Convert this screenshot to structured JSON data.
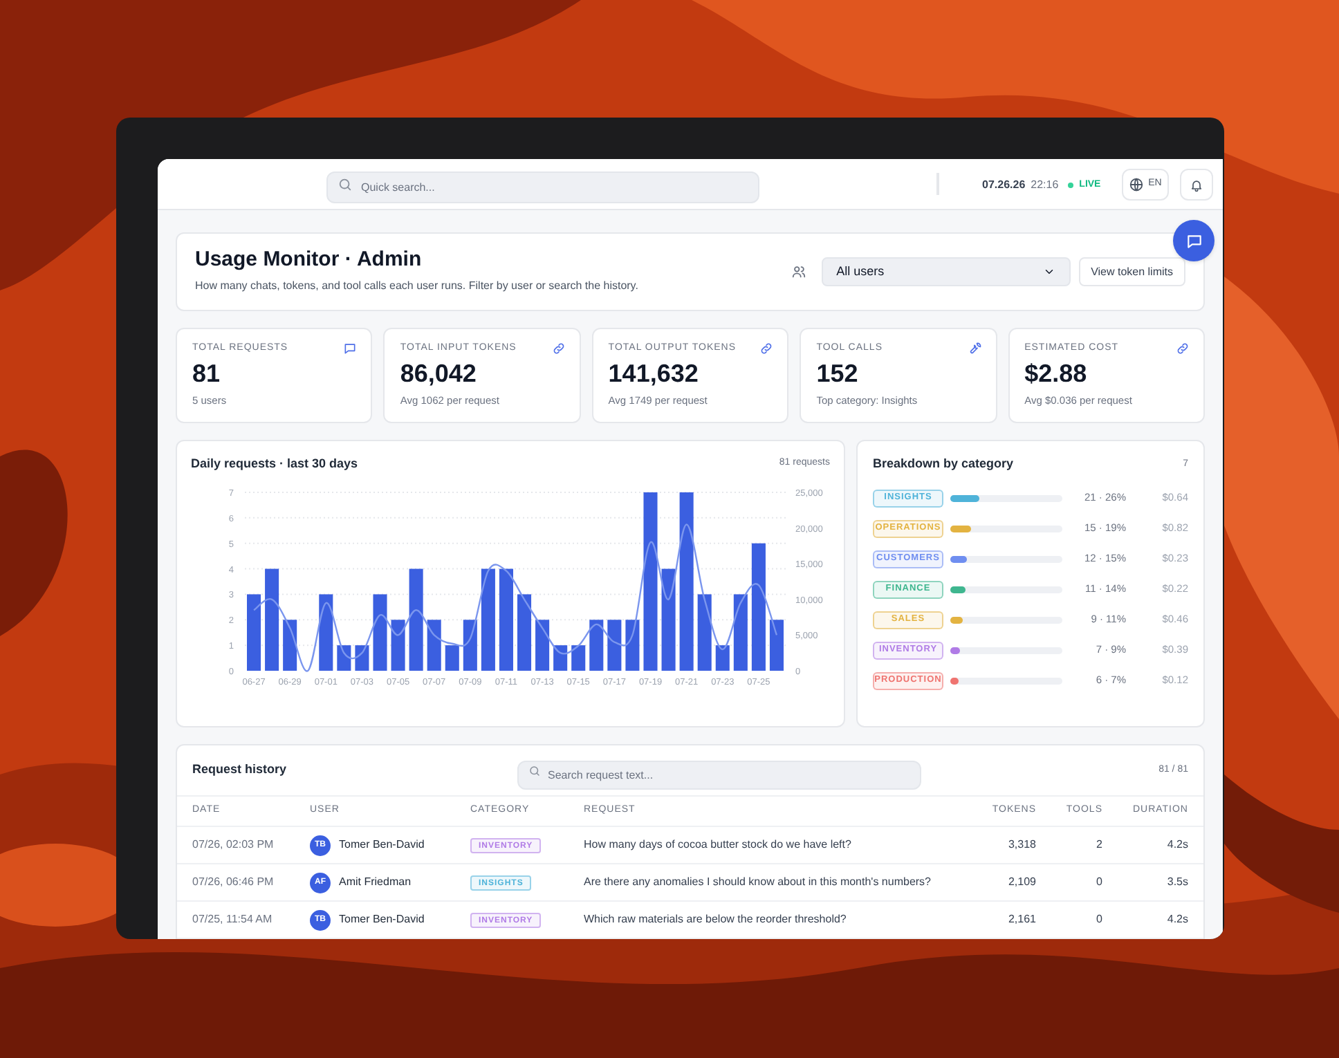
{
  "topbar": {
    "search": {
      "placeholder": "Quick search..."
    },
    "date": "07.26.26",
    "time": "22:16",
    "live": "LIVE",
    "language": "EN"
  },
  "header": {
    "title": "Usage Monitor · Admin",
    "subtitle": "How many chats, tokens, and tool calls each user runs. Filter by user or search the history.",
    "user_filter": "All users",
    "limits_button": "View token limits"
  },
  "stats": [
    {
      "label": "TOTAL REQUESTS",
      "value": "81",
      "note": "5 users"
    },
    {
      "label": "TOTAL INPUT TOKENS",
      "value": "86,042",
      "note": "Avg 1062 per request"
    },
    {
      "label": "TOTAL OUTPUT TOKENS",
      "value": "141,632",
      "note": "Avg 1749 per request"
    },
    {
      "label": "TOOL CALLS",
      "value": "152",
      "note": "Top category: Insights"
    },
    {
      "label": "ESTIMATED COST",
      "value": "$2.88",
      "note": "Avg $0.036 per request"
    }
  ],
  "daily": {
    "title": "Daily requests · last 30 days",
    "count": "81 requests",
    "chart_data": {
      "type": "bar",
      "grid": true,
      "categories": [
        "06-27",
        null,
        "06-29",
        null,
        "07-01",
        null,
        "07-03",
        null,
        "07-05",
        null,
        "07-07",
        null,
        "07-09",
        null,
        "07-11",
        null,
        "07-13",
        null,
        "07-15",
        null,
        "07-17",
        null,
        "07-19",
        null,
        "07-21",
        null,
        "07-23",
        null,
        "07-25",
        null
      ],
      "series": [
        {
          "color": "#3b5fe0",
          "values": [
            3,
            4,
            2,
            0,
            3,
            1,
            1,
            3,
            2,
            4,
            2,
            1,
            2,
            4,
            4,
            3,
            2,
            1,
            1,
            2,
            2,
            2,
            7,
            4,
            7,
            3,
            1,
            3,
            5,
            2
          ]
        }
      ],
      "ylim": [
        0,
        7
      ],
      "yticks": [
        0,
        1,
        2,
        3,
        4,
        5,
        6,
        7
      ]
    },
    "tokens": {
      "chart_data": {
        "type": "line",
        "series": [
          {
            "color": "#7b96ee",
            "values": [
              8500,
              10000,
              6000,
              0,
              9500,
              2500,
              2500,
              7800,
              5000,
              8500,
              5000,
              3800,
              4500,
              14000,
              14000,
              10000,
              6000,
              2500,
              3500,
              6500,
              4000,
              5000,
              18000,
              10000,
              20500,
              10000,
              3000,
              9500,
              12000,
              5000
            ]
          }
        ],
        "ylim": [
          0,
          25000
        ],
        "yticks": [
          {
            "value": 0,
            "label": "0"
          },
          {
            "value": 5000,
            "label": "5,000"
          },
          {
            "value": 10000,
            "label": "10,000"
          },
          {
            "value": 15000,
            "label": "15,000"
          },
          {
            "value": 20000,
            "label": "20,000"
          },
          {
            "value": 25000,
            "label": "25,000"
          }
        ]
      }
    }
  },
  "breakdown": {
    "title": "Breakdown by category",
    "count": "7",
    "categories": [
      {
        "label": "INSIGHTS",
        "color": "#4fb3d9",
        "level": 0.26,
        "share": "21 · 26%",
        "cost": "$0.64"
      },
      {
        "label": "OPERATIONS",
        "color": "#e3b341",
        "level": 0.19,
        "share": "15 · 19%",
        "cost": "$0.82"
      },
      {
        "label": "CUSTOMERS",
        "color": "#6f8ef0",
        "level": 0.15,
        "share": "12 · 15%",
        "cost": "$0.23"
      },
      {
        "label": "FINANCE",
        "color": "#3fb68f",
        "level": 0.14,
        "share": "11 · 14%",
        "cost": "$0.22"
      },
      {
        "label": "SALES",
        "color": "#e3b341",
        "level": 0.11,
        "share": "9 · 11%",
        "cost": "$0.46"
      },
      {
        "label": "INVENTORY",
        "color": "#b07be6",
        "level": 0.09,
        "share": "7 · 9%",
        "cost": "$0.39"
      },
      {
        "label": "PRODUCTION",
        "color": "#ef7470",
        "level": 0.07,
        "share": "6 · 7%",
        "cost": "$0.12"
      }
    ]
  },
  "history": {
    "title": "Request history",
    "search": {
      "placeholder": "Search request text..."
    },
    "count": "81 / 81",
    "columns": [
      "DATE",
      "USER",
      "CATEGORY",
      "REQUEST",
      "TOKENS",
      "TOOLS",
      "DURATION"
    ],
    "rows": [
      {
        "date": "07/26, 02:03 PM",
        "initials": "TB",
        "user": "Tomer Ben-David",
        "category": {
          "label": "INVENTORY",
          "color": "#b07be6"
        },
        "request": "How many days of cocoa butter stock do we have left?",
        "tokens": "3,318",
        "tools": "2",
        "duration": "4.2s"
      },
      {
        "date": "07/26, 06:46 PM",
        "initials": "AF",
        "user": "Amit Friedman",
        "category": {
          "label": "INSIGHTS",
          "color": "#4fb3d9"
        },
        "request": "Are there any anomalies I should know about in this month's numbers?",
        "tokens": "2,109",
        "tools": "0",
        "duration": "3.5s"
      },
      {
        "date": "07/25, 11:54 AM",
        "initials": "TB",
        "user": "Tomer Ben-David",
        "category": {
          "label": "INVENTORY",
          "color": "#b07be6"
        },
        "request": "Which raw materials are below the reorder threshold?",
        "tokens": "2,161",
        "tools": "0",
        "duration": "4.2s"
      }
    ]
  }
}
